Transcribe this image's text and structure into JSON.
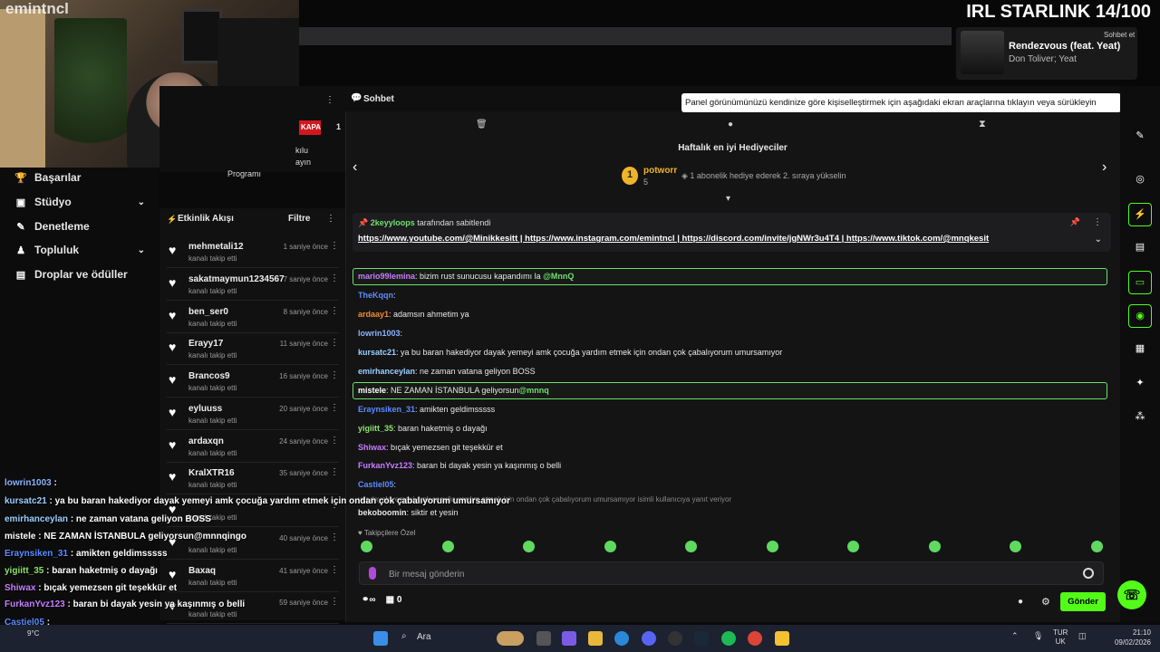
{
  "stream": {
    "brand": "emintncl",
    "overlay_title": "IRL STARLINK 14/100",
    "now_playing": {
      "song": "Rendezvous (feat. Yeat)",
      "artist": "Don Toliver; Yeat"
    },
    "sohbet_et": "Sohbet et"
  },
  "left_nav": {
    "items": [
      {
        "label": "Başarılar",
        "icon": "trophy-icon",
        "chevron": false
      },
      {
        "label": "Stüdyo",
        "icon": "video-icon",
        "chevron": true
      },
      {
        "label": "Denetleme",
        "icon": "wrench-icon",
        "chevron": false
      },
      {
        "label": "Topluluk",
        "icon": "community-icon",
        "chevron": true
      },
      {
        "label": "Droplar ve ödüller",
        "icon": "gift-icon",
        "chevron": false
      }
    ]
  },
  "feed_header": {
    "kapali": "KAPALI",
    "partial1": "kılu",
    "partial2": "ayın",
    "partial3": "Programı"
  },
  "activity": {
    "title": "Etkinlik Akışı",
    "filter": "Filtre",
    "sub_label": "kanalı takip etti",
    "items": [
      {
        "name": "mehmetali12",
        "time": "1 saniye önce"
      },
      {
        "name": "sakatmaymun1234567",
        "time": "7 saniye önce"
      },
      {
        "name": "ben_ser0",
        "time": "8 saniye önce"
      },
      {
        "name": "Erayy17",
        "time": "11 saniye önce"
      },
      {
        "name": "Brancos9",
        "time": "16 saniye önce"
      },
      {
        "name": "eyluuss",
        "time": "20 saniye önce"
      },
      {
        "name": "ardaxqn",
        "time": "24 saniye önce"
      },
      {
        "name": "KralXTR16",
        "time": "35 saniye önce"
      },
      {
        "name": "",
        "time": ""
      },
      {
        "name": "",
        "time": "40 saniye önce"
      },
      {
        "name": "Baxaq",
        "time": "41 saniye önce"
      },
      {
        "name": "",
        "time": "59 saniye önce"
      }
    ]
  },
  "chat": {
    "header": "Sohbet",
    "tooltip": "Panel görünümünüzü kendinize göre kişiselleştirmek için aşağıdaki ekran araçlarına tıklayın veya sürükleyin",
    "gifters_title": "Haftalık en iyi Hediyeciler",
    "top_gifter": {
      "rank": "1",
      "name": "potworr",
      "count": "5"
    },
    "gift_tip": "1 abonelik hediye ederek 2. sıraya yükselin",
    "pinned_by_user": "2keyyloops",
    "pinned_by_suffix": "tarafından sabitlendi",
    "pinned_links": "https://www.youtube.com/@Minikkesitt | https://www.instagram.com/emintncl | https://discord.com/invite/jgNWr3u4T4 | https://www.tiktok.com/@mnqkesit",
    "messages": [
      {
        "user": "mario99lemina",
        "color": "#c77dff",
        "text": ": bizim rust sunucusu kapandımı la ",
        "mention": "@MnnQ",
        "highlight": true
      },
      {
        "user": "TheKqqn",
        "color": "#5b8cff",
        "text": ":",
        "mention": "",
        "highlight": false
      },
      {
        "user": "ardaay1",
        "color": "#f08c2a",
        "text": ": adamsın ahmetim ya",
        "mention": "",
        "highlight": false
      },
      {
        "user": "lowrin1003",
        "color": "#8ab4ff",
        "text": ":",
        "mention": "",
        "highlight": false
      },
      {
        "user": "kursatc21",
        "color": "#9ad0ff",
        "text": ": ya bu baran hakediyor dayak yemeyi amk çocuğa yardım etmek için ondan çok çabalıyorum umursamıyor",
        "mention": "",
        "highlight": false
      },
      {
        "user": "emirhanceylan",
        "color": "#9ad0ff",
        "text": ": ne zaman vatana geliyon BOSS",
        "mention": "",
        "highlight": false
      },
      {
        "user": "mistele",
        "color": "#ffffff",
        "text": ": NE ZAMAN İSTANBULA geliyorsun",
        "mention": "@mnnq",
        "highlight": true
      },
      {
        "user": "Eraynsiken_31",
        "color": "#5b8cff",
        "text": ": amikten geldimsssss",
        "mention": "",
        "highlight": false
      },
      {
        "user": "yigiitt_35",
        "color": "#8be36b",
        "text": ": baran haketmiş o dayağı",
        "mention": "",
        "highlight": false
      },
      {
        "user": "Shiwax",
        "color": "#c77dff",
        "text": ": bıçak yemezsen git teşekkür et",
        "mention": "",
        "highlight": false
      },
      {
        "user": "FurkanYvz123",
        "color": "#c77dff",
        "text": ": baran bi dayak yesin ya kaşınmış o belli",
        "mention": "",
        "highlight": false
      },
      {
        "user": "Castiel05",
        "color": "#5b8cff",
        "text": ":",
        "mention": "",
        "highlight": false
      }
    ],
    "reply_hint": "yor dayak yemeyi amk çocuğa yardım etmek için ondan çok çabalıyorum umursamıyor isimli kullanıcıya yanıt veriyor",
    "last_msg_user": "bekoboomin",
    "last_msg_text": ": siktir et yesin",
    "emote_label": "Takipçilere Özel",
    "input_placeholder": "Bir mesaj gönderin",
    "bottom_count": "0",
    "send_label": "Gönder"
  },
  "overlay_chat": [
    {
      "user": "lowrin1003",
      "color": "#8ab4ff",
      "text": " :"
    },
    {
      "user": "kursatc21",
      "color": "#9ad0ff",
      "text": " : ya bu baran hakediyor dayak yemeyi amk çocuğa yardım etmek için ondan çok çabalıyorum umursamıyor"
    },
    {
      "user": "emirhanceylan",
      "color": "#9ad0ff",
      "text": " : ne zaman vatana geliyon BOSS"
    },
    {
      "user": "mistele",
      "color": "#ffffff",
      "text": " : NE ZAMAN İSTANBULA geliyorsun@mnnqingo"
    },
    {
      "user": "Eraynsiken_31",
      "color": "#5b8cff",
      "text": " : amikten geldimsssss"
    },
    {
      "user": "yigiitt_35",
      "color": "#8be36b",
      "text": " : baran haketmiş o dayağı"
    },
    {
      "user": "Shiwax",
      "color": "#c77dff",
      "text": " : bıçak yemezsen git teşekkür et"
    },
    {
      "user": "FurkanYvz123",
      "color": "#c77dff",
      "text": " : baran bi dayak yesin ya kaşınmış o belli"
    },
    {
      "user": "Castiel05",
      "color": "#5b8cff",
      "text": " :"
    },
    {
      "user": "bekoboomin",
      "color": "#ffffff",
      "text": " : siktir et yesin"
    }
  ],
  "taskbar": {
    "search": "Ara",
    "weather": "9°C",
    "lang1": "TUR",
    "lang2": "UK",
    "time": "21:10",
    "date": "09/02/2026"
  },
  "colors": {
    "accent": "#53fc18",
    "live": "#d4161d"
  }
}
